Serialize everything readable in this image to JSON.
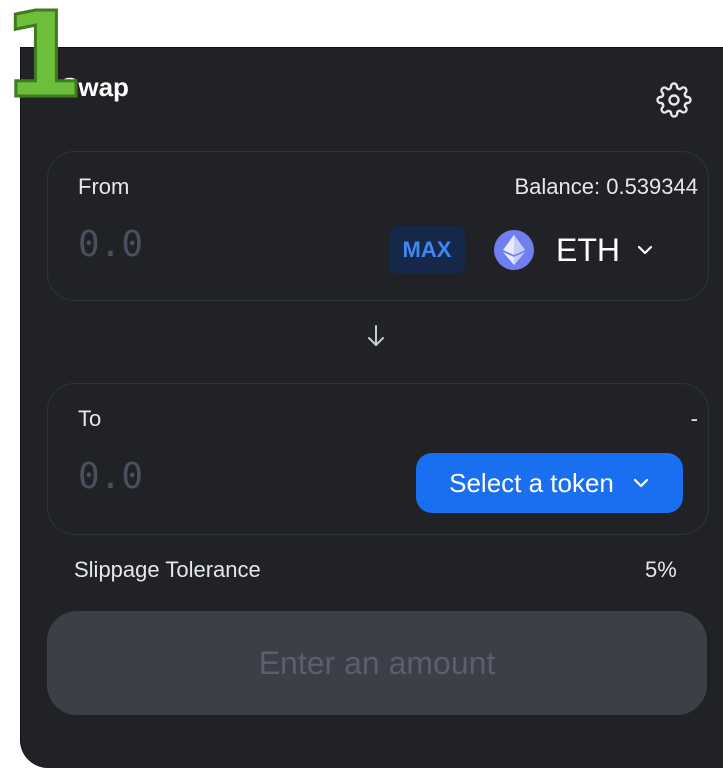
{
  "step_badge": "1",
  "swap": {
    "title": "Swap",
    "settings_icon": "gear-icon",
    "from": {
      "label": "From",
      "balance": "Balance: 0.539344",
      "amount_placeholder": "0.0",
      "max_label": "MAX",
      "token_icon": "ethereum-icon",
      "token_symbol": "ETH"
    },
    "direction_icon": "arrow-down-icon",
    "to": {
      "label": "To",
      "balance": "-",
      "amount_placeholder": "0.0",
      "select_token_label": "Select a token"
    },
    "slippage": {
      "label": "Slippage Tolerance",
      "value": "5%"
    },
    "submit_label": "Enter an amount"
  },
  "colors": {
    "panel_bg": "#202226",
    "accent_blue": "#1a6ff0",
    "max_bg": "#16284a",
    "eth_purple": "#6f7ff0",
    "badge_green": "#6dbf3b",
    "disabled_button": "#3c3e48"
  }
}
